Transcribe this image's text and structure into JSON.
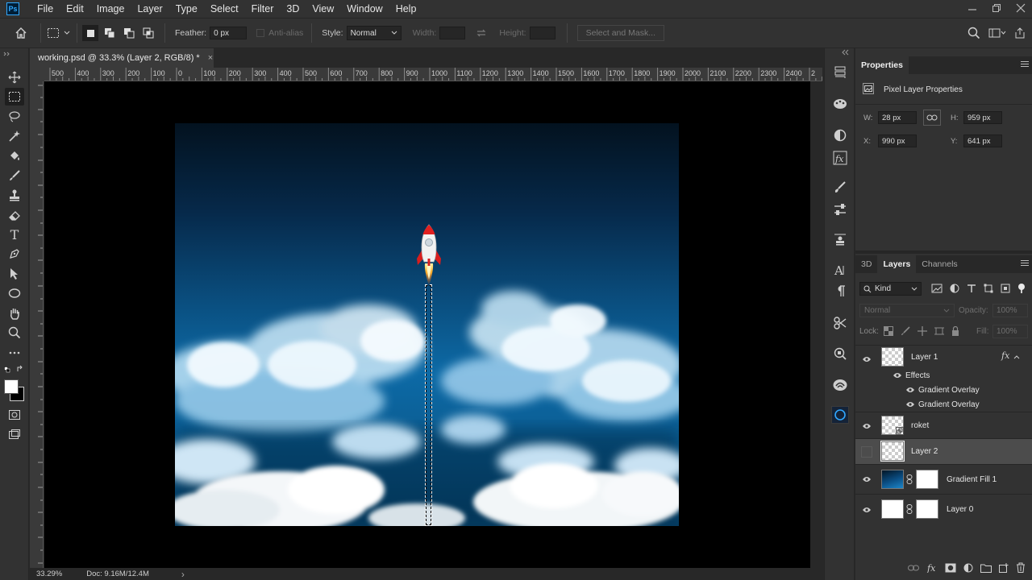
{
  "app": {
    "logo_text": "Ps"
  },
  "menu": [
    "File",
    "Edit",
    "Image",
    "Layer",
    "Type",
    "Select",
    "Filter",
    "3D",
    "View",
    "Window",
    "Help"
  ],
  "options_bar": {
    "feather_label": "Feather:",
    "feather_value": "0 px",
    "antialias_label": "Anti-alias",
    "style_label": "Style:",
    "style_value": "Normal",
    "width_label": "Width:",
    "height_label": "Height:",
    "select_mask_label": "Select and Mask..."
  },
  "document": {
    "tab_title": "working.psd @ 33.3% (Layer 2, RGB/8) *",
    "close_glyph": "×",
    "ruler_labels": [
      "500",
      "400",
      "300",
      "200",
      "100",
      "0",
      "100",
      "200",
      "300",
      "400",
      "500",
      "600",
      "700",
      "800",
      "900",
      "1000",
      "1100",
      "1200",
      "1300",
      "1400",
      "1500",
      "1600",
      "1700",
      "1800",
      "1900",
      "2000",
      "2100",
      "2200",
      "2300",
      "2400",
      "2"
    ],
    "zoom": "33.29%",
    "doc_size": "Doc: 9.16M/12.4M",
    "status_arrow": "›"
  },
  "properties": {
    "tab_label": "Properties",
    "section_title": "Pixel Layer Properties",
    "w_label": "W:",
    "w_value": "28 px",
    "h_label": "H:",
    "h_value": "959 px",
    "x_label": "X:",
    "x_value": "990 px",
    "y_label": "Y:",
    "y_value": "641 px"
  },
  "layers_panel": {
    "tabs": [
      "3D",
      "Layers",
      "Channels"
    ],
    "kind_label": "Kind",
    "blend_mode": "Normal",
    "opacity_label": "Opacity:",
    "opacity_value": "100%",
    "lock_label": "Lock:",
    "fill_label": "Fill:",
    "fill_value": "100%",
    "layers": [
      {
        "name": "Layer 1",
        "fx": "fx"
      },
      {
        "name": "roket"
      },
      {
        "name": "Layer 2"
      },
      {
        "name": "Gradient Fill 1"
      },
      {
        "name": "Layer 0"
      }
    ],
    "effects_label": "Effects",
    "effects": [
      "Gradient Overlay",
      "Gradient Overlay"
    ]
  },
  "colors": {
    "ps_blue": "#31a8ff",
    "selected_row": "#4c4c4c",
    "rocket_red": "#d81e1e"
  }
}
